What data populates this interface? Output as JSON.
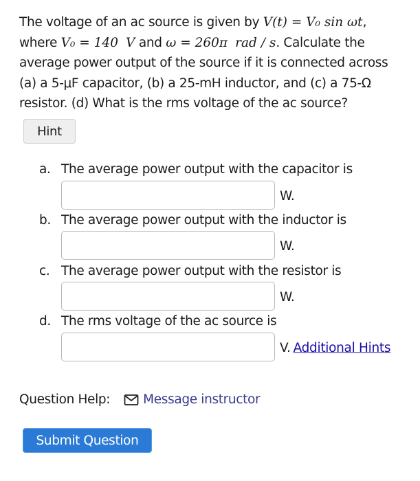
{
  "problem": {
    "line1_text": "The voltage of an ac source is given by ",
    "line1_math": "V(t) = V₀ sin ωt",
    "line1_end": ",",
    "line2_start": "where ",
    "v0_math": "V₀ = 140",
    "v0_unit": "V",
    "and_text": " and ",
    "omega_math": "ω = 260π",
    "omega_unit": "rad / s",
    "line2_end": ". Calculate the",
    "rest_text": "average power output of the source if it is connected across (a) a 5-μF capacitor, (b) a 25-mH inductor, and (c) a 75-Ω resistor. (d) What is the rms voltage of the ac source?"
  },
  "hint_button": "Hint",
  "parts": [
    {
      "letter": "a.",
      "label": "The average power output with the capacitor is",
      "value": "",
      "unit": "W."
    },
    {
      "letter": "b.",
      "label": "The average power output with the inductor is",
      "value": "",
      "unit": "W."
    },
    {
      "letter": "c.",
      "label": "The average power output with the resistor is",
      "value": "",
      "unit": "W."
    },
    {
      "letter": "d.",
      "label": "The rms voltage of the ac source is",
      "value": "",
      "unit": "V."
    }
  ],
  "additional_hints_link": "Additional Hints",
  "question_help": {
    "label": "Question Help:",
    "icon": "mail-icon",
    "message_link": "Message instructor"
  },
  "submit_button": "Submit Question",
  "colors": {
    "submit_bg": "#2b7bd6",
    "link_blue": "#1a0dab",
    "message_link": "#3a3a8c"
  }
}
